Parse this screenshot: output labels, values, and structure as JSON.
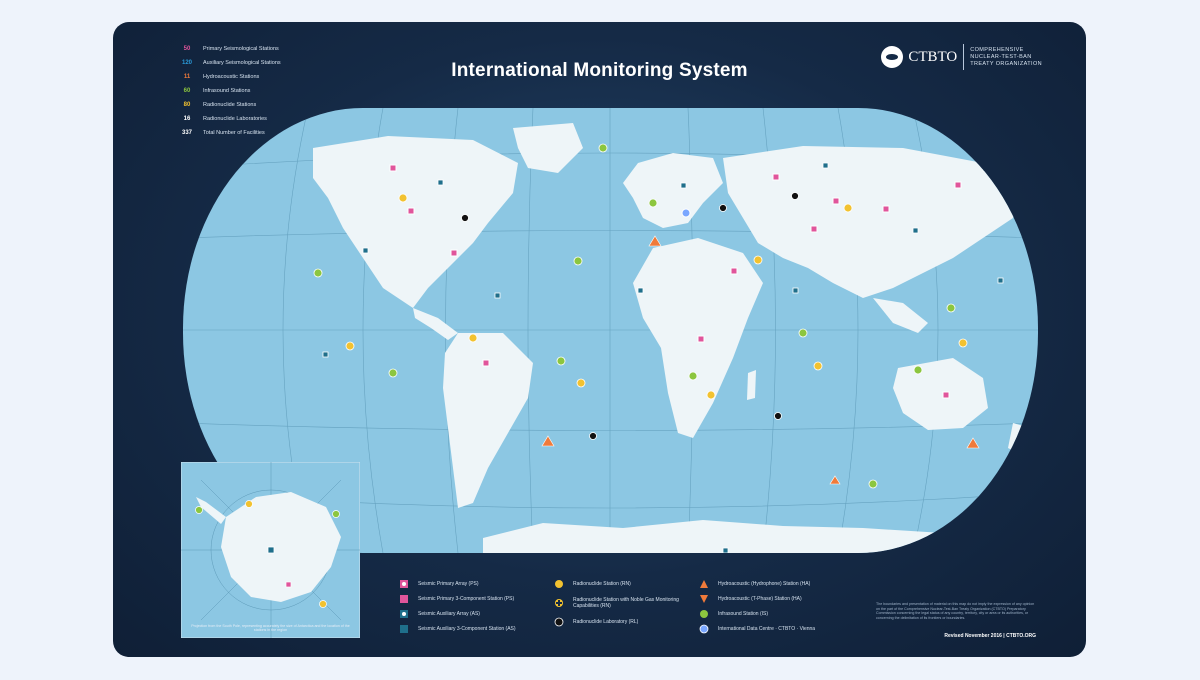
{
  "title": "International Monitoring System",
  "logo": {
    "wordmark": "CTBTO",
    "full_name": [
      "COMPREHENSIVE",
      "NUCLEAR-TEST-BAN",
      "TREATY ORGANIZATION"
    ]
  },
  "stats": [
    {
      "count": "50",
      "label": "Primary Seismological Stations",
      "color": "#e0559b"
    },
    {
      "count": "120",
      "label": "Auxiliary Seismological Stations",
      "color": "#2a9ad8"
    },
    {
      "count": "11",
      "label": "Hydroacoustic Stations",
      "color": "#f07a3a"
    },
    {
      "count": "60",
      "label": "Infrasound Stations",
      "color": "#8cc63f"
    },
    {
      "count": "80",
      "label": "Radionuclide Stations",
      "color": "#f2c230"
    },
    {
      "count": "16",
      "label": "Radionuclide Laboratories",
      "color": "#ffffff"
    },
    {
      "count": "337",
      "label": "Total Number of Facilities",
      "color": "#ffffff"
    }
  ],
  "legend": [
    {
      "icon": "seismic-primary-array",
      "label": "Seismic Primary Array (PS)",
      "color": "#e0559b"
    },
    {
      "icon": "seismic-primary-3c",
      "label": "Seismic Primary 3-Component Station (PS)",
      "color": "#e0559b"
    },
    {
      "icon": "seismic-auxiliary-array",
      "label": "Seismic Auxiliary Array (AS)",
      "color": "#1f6f8b"
    },
    {
      "icon": "seismic-auxiliary-3c",
      "label": "Seismic Auxiliary 3-Component Station (AS)",
      "color": "#1f6f8b"
    },
    {
      "icon": "radionuclide-station",
      "label": "Radionuclide Station (RN)",
      "color": "#f2c230"
    },
    {
      "icon": "radionuclide-noble-gas",
      "label": "Radionuclide Station with Noble Gas Monitoring Capabilities (RN)",
      "color": "#f2c230"
    },
    {
      "icon": "radionuclide-laboratory",
      "label": "Radionuclide Laboratory (RL)",
      "color": "#111111"
    },
    {
      "icon": "hydroacoustic-hydrophone",
      "label": "Hydroacoustic (Hydrophone) Station (HA)",
      "color": "#f07a3a"
    },
    {
      "icon": "hydroacoustic-t-phase",
      "label": "Hydroacoustic (T-Phase) Station (HA)",
      "color": "#f07a3a"
    },
    {
      "icon": "infrasound-station",
      "label": "Infrasound Station (IS)",
      "color": "#8cc63f"
    },
    {
      "icon": "international-data-centre",
      "label": "International Data Centre · CTBTO · Vienna",
      "color": "#7aa7ff"
    }
  ],
  "inset_caption": "Projection from the South Pole, representing accurately the size of Antarctica and the location of the stations in the region",
  "disclaimer": "The boundaries and presentation of material on this map do not imply the expression of any opinion on the part of the Comprehensive Nuclear-Test-Ban Treaty Organization (CTBTO) Preparatory Commission concerning the legal status of any country, territory, city or area or its authorities, or concerning the delimitation of its frontiers or boundaries.",
  "revised": "Revised November 2016 | CTBTO.ORG",
  "colors": {
    "ocean": "#8cc7e3",
    "land": "#eef5f8",
    "grid": "#5d9ab8",
    "poster_bg": "#152a46"
  }
}
